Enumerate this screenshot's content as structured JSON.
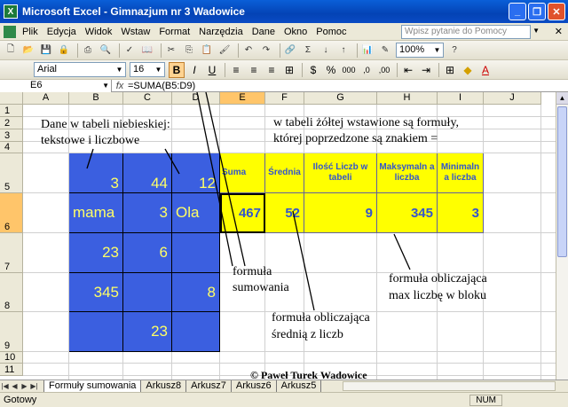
{
  "window": {
    "title": "Microsoft Excel - Gimnazjum nr 3 Wadowice",
    "app_icon": "X"
  },
  "menu": {
    "items": [
      "Plik",
      "Edycja",
      "Widok",
      "Wstaw",
      "Format",
      "Narzędzia",
      "Dane",
      "Okno",
      "Pomoc"
    ],
    "help_placeholder": "Wpisz pytanie do Pomocy"
  },
  "toolbar": {
    "zoom": "100%",
    "font": "Arial",
    "font_size": "16"
  },
  "formula_bar": {
    "name_box": "E6",
    "fx": "fx",
    "formula": "=SUMA(B5:D9)"
  },
  "columns": [
    "A",
    "B",
    "C",
    "D",
    "E",
    "F",
    "G",
    "H",
    "I",
    "J"
  ],
  "rows": [
    "1",
    "2",
    "3",
    "4",
    "5",
    "6",
    "7",
    "8",
    "9",
    "10",
    "11"
  ],
  "cells": {
    "B5": "3",
    "C5": "44",
    "D5": "12",
    "B6": "mama",
    "C6": "3",
    "D6": "Ola",
    "B7": "23",
    "C7": "6",
    "B8": "345",
    "D8": "8",
    "C9": "23",
    "E5": "Suma",
    "F5": "Średnia",
    "G5": "Ilość Liczb w tabeli",
    "H5": "Maksymaln a liczba",
    "I5": "Minimaln a liczba",
    "E6": "467",
    "F6": "52",
    "G6": "9",
    "H6": "345",
    "I6": "3"
  },
  "notes": {
    "blue_line1": "Dane w tabeli niebieskiej:",
    "blue_line2": "tekstowe i liczbowe",
    "yellow_line1": "w tabeli żółtej wstawione są formuły,",
    "yellow_line2": "której poprzedzone są znakiem =",
    "sum_line1": "formuła",
    "sum_line2": "sumowania",
    "avg_line1": "formuła obliczająca",
    "avg_line2": "średnią z liczb",
    "max_line1": "formuła obliczająca",
    "max_line2": "max liczbę w bloku",
    "copyright": "© Paweł Turek Wadowice"
  },
  "sheet_tabs": [
    "Formuły sumowania",
    "Arkusz8",
    "Arkusz7",
    "Arkusz6",
    "Arkusz5"
  ],
  "status": {
    "left": "Gotowy",
    "num": "NUM"
  },
  "colors": {
    "blue_table": "#3b5fe0",
    "blue_text": "#ffff66",
    "yellow_table": "#ffff00",
    "yellow_text": "#3355cc"
  }
}
